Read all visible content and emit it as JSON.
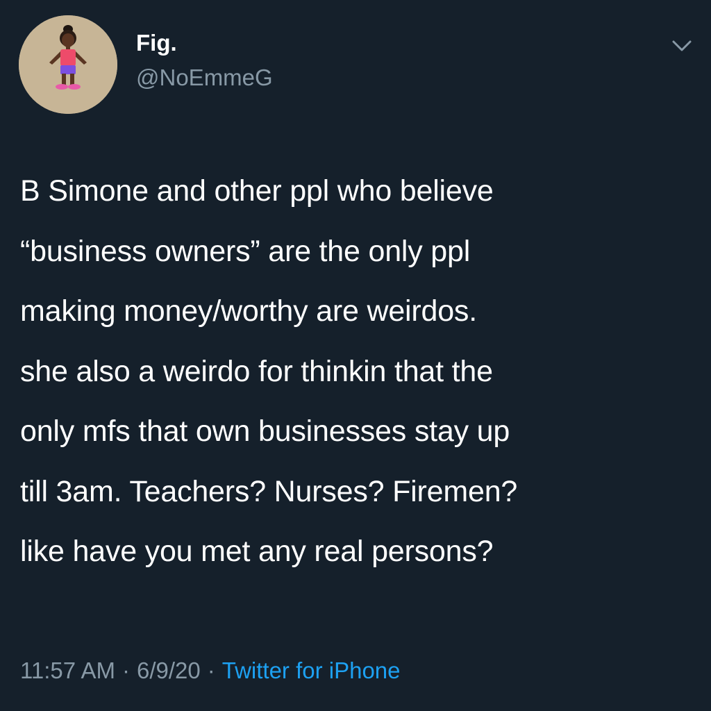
{
  "user": {
    "display_name": "Fig.",
    "handle": "@NoEmmeG",
    "avatar_icon": "avatar-figure-image"
  },
  "menu": {
    "icon": "chevron-down-icon",
    "color": "#8899a6"
  },
  "tweet": {
    "text": "B Simone and other ppl who believe\n“business owners”  are the only ppl\nmaking money/worthy are weirdos.\nshe also a weirdo for thinkin that the\nonly mfs that own businesses stay up\ntill 3am. Teachers? Nurses? Firemen?\nlike have you met any real persons?"
  },
  "meta": {
    "time": "11:57 AM",
    "separator": "·",
    "date": "6/9/20",
    "source": "Twitter for iPhone"
  },
  "colors": {
    "background": "#15202b",
    "text_primary": "#ffffff",
    "text_secondary": "#8899a6",
    "link": "#1da1f2"
  }
}
